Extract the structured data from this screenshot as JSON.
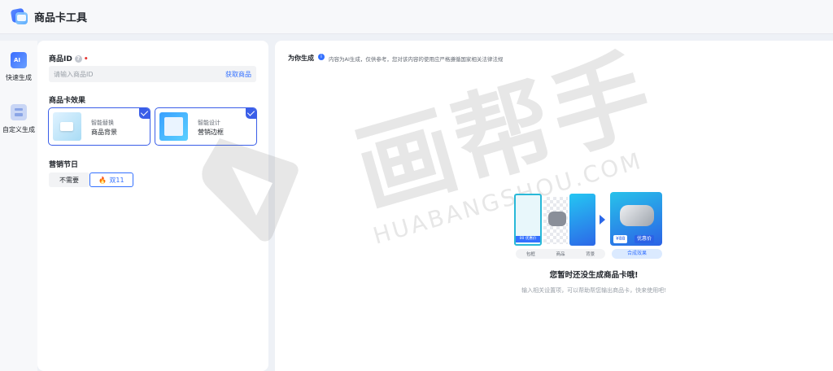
{
  "header": {
    "title": "商品卡工具"
  },
  "rail": {
    "items": [
      {
        "label": "快速生成",
        "icon": "ai-quick-icon"
      },
      {
        "label": "自定义生成",
        "icon": "custom-icon"
      }
    ]
  },
  "form": {
    "product_id": {
      "label": "商品ID",
      "help": "?",
      "required_mark": "•",
      "placeholder": "请输入商品ID",
      "value": "",
      "fetch_label": "获取商品"
    },
    "effect": {
      "label": "商品卡效果",
      "options": [
        {
          "sub": "智能替换",
          "main": "商品背景",
          "selected": true
        },
        {
          "sub": "智能设计",
          "main": "营销边框",
          "selected": true
        }
      ]
    },
    "festival": {
      "label": "营销节日",
      "options": [
        {
          "label": "不需要",
          "selected": false
        },
        {
          "label": "双11",
          "selected": true
        }
      ]
    }
  },
  "result": {
    "title": "为你生成",
    "info_icon": "i",
    "notice": "内容为AI生成，仅供参考，您对该内容的使用应严格遵循国家相关法律法规",
    "illustration": {
      "card_tag": "00 优惠价",
      "steps": [
        "包框",
        "商品",
        "背景"
      ],
      "price": "¥88",
      "badge": "优惠价",
      "result_label": "合成效果"
    },
    "empty_title": "您暂时还没生成商品卡哦!",
    "empty_sub": "输入相关设置项，可以帮助帮您输出商品卡，快来使用吧!"
  },
  "watermark": {
    "big": "画帮手",
    "small": "HUABANGSHOU.COM"
  },
  "colors": {
    "accent": "#3370ff",
    "selected_border": "#3a5ee8",
    "page_bg": "#eef1f6"
  }
}
